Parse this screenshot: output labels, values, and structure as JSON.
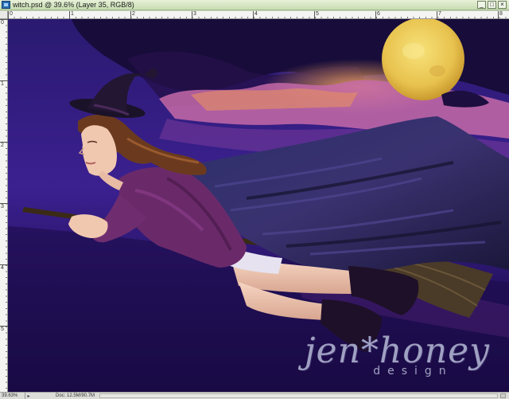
{
  "window": {
    "title": "witch.psd @ 39.6% (Layer 35, RGB/8)",
    "controls": [
      "_",
      "□",
      "×"
    ]
  },
  "rulers": {
    "top_marks": [
      "0",
      "1",
      "2",
      "3",
      "4",
      "5",
      "6",
      "7",
      "8"
    ],
    "left_marks": [
      "0",
      "1",
      "2",
      "3",
      "4",
      "5"
    ]
  },
  "artwork": {
    "watermark_main": "jen*honey",
    "watermark_sub": "design",
    "colors": {
      "sky_deep": "#1c0f55",
      "sky_mid": "#3a1d84",
      "cloud_pink": "#c86aa6",
      "cloud_orange": "#e09a55",
      "moon": "#f0d060",
      "cape": "#2a2550",
      "dress": "#6a2a6a",
      "skin": "#f0c8b0",
      "hair": "#6b3a1e",
      "hat": "#1a1228"
    }
  },
  "statusbar": {
    "zoom": "39.63%",
    "doc_size": "Doc: 12.5M/90.7M",
    "arrow": "▸"
  }
}
